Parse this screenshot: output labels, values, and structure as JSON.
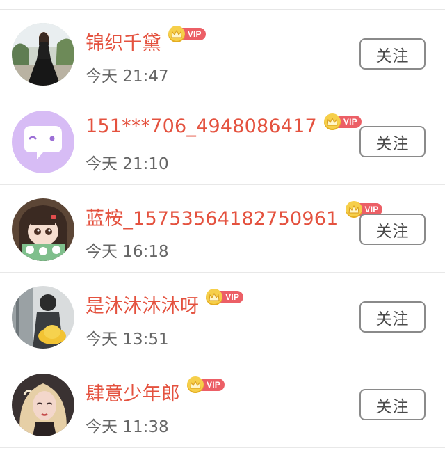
{
  "follow_label": "关注",
  "vip_label": "VIP",
  "users": [
    {
      "name": "锦织千黛",
      "time": "今天 21:47",
      "avatar_icon": "avatar-woman-dress-photo"
    },
    {
      "name": "151***706_4948086417",
      "time": "今天 21:10",
      "avatar_icon": "avatar-chat-bubble-default"
    },
    {
      "name": "蓝桉_15753564182750961",
      "time": "今天 16:18",
      "avatar_icon": "avatar-cartoon-girl"
    },
    {
      "name": "是沐沐沐沐呀",
      "time": "今天 13:51",
      "avatar_icon": "avatar-boy-yellow-hat"
    },
    {
      "name": "肆意少年郎",
      "time": "今天 11:38",
      "avatar_icon": "avatar-illustrated-girl"
    }
  ],
  "colors": {
    "name": "#e4523f",
    "time": "#666666",
    "vip_tag": "#ec5f66",
    "crown": "#f6cf4a",
    "default_avatar_bg": "#d7bcf5"
  }
}
